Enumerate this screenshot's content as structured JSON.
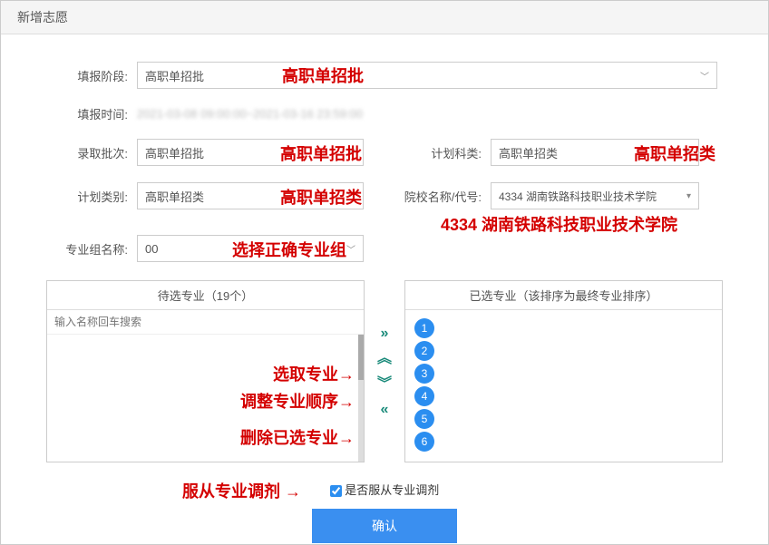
{
  "header": {
    "title": "新增志愿"
  },
  "form": {
    "stage_label": "填报阶段:",
    "stage_value": "高职单招批",
    "time_label": "填报时间:",
    "time_value": "2021-03-08 09:00:00~2021-03-16 23:59:00",
    "batch_label": "录取批次:",
    "batch_value": "高职单招批",
    "subject_label": "计划科类:",
    "subject_value": "高职单招类",
    "category_label": "计划类别:",
    "category_value": "高职单招类",
    "school_label": "院校名称/代号:",
    "school_value": "4334 湖南铁路科技职业技术学院",
    "group_label": "专业组名称:",
    "group_value": "00"
  },
  "transfer": {
    "left_header": "待选专业（19个）",
    "right_header": "已选专业（该排序为最终专业排序）",
    "search_placeholder": "输入名称回车搜索",
    "badges": [
      "1",
      "2",
      "3",
      "4",
      "5",
      "6"
    ]
  },
  "checkbox": {
    "label": "是否服从专业调剂"
  },
  "confirm": {
    "label": "确认"
  },
  "annotations": {
    "stage": "高职单招批",
    "batch": "高职单招批",
    "subject": "高职单招类",
    "category": "高职单招类",
    "school": "4334 湖南铁路科技职业技术学院",
    "group": "选择正确专业组",
    "select_major": "选取专业",
    "reorder": "调整专业顺序",
    "delete": "删除已选专业",
    "obey": "服从专业调剂"
  }
}
